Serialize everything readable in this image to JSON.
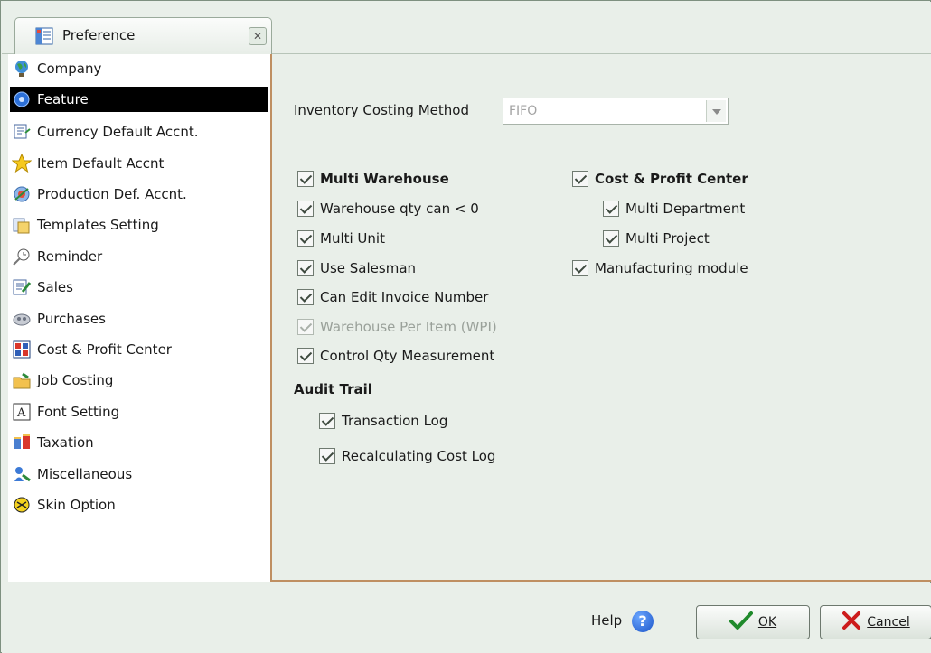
{
  "tab": {
    "title": "Preference",
    "close_glyph": "✕"
  },
  "sidebar": {
    "items": [
      {
        "label": "Company",
        "icon": "globe-icon",
        "selected": false
      },
      {
        "label": "Feature",
        "icon": "feature-icon",
        "selected": true
      },
      {
        "label": "Currency Default Accnt.",
        "icon": "currency-icon",
        "selected": false
      },
      {
        "label": "Item Default Accnt",
        "icon": "star-icon",
        "selected": false
      },
      {
        "label": "Production Def. Accnt.",
        "icon": "production-icon",
        "selected": false
      },
      {
        "label": "Templates Setting",
        "icon": "templates-icon",
        "selected": false
      },
      {
        "label": "Reminder",
        "icon": "reminder-icon",
        "selected": false
      },
      {
        "label": "Sales",
        "icon": "sales-icon",
        "selected": false
      },
      {
        "label": "Purchases",
        "icon": "purchases-icon",
        "selected": false
      },
      {
        "label": "Cost & Profit Center",
        "icon": "cost-center-icon",
        "selected": false
      },
      {
        "label": "Job Costing",
        "icon": "job-costing-icon",
        "selected": false
      },
      {
        "label": "Font Setting",
        "icon": "font-icon",
        "selected": false
      },
      {
        "label": "Taxation",
        "icon": "taxation-icon",
        "selected": false
      },
      {
        "label": "Miscellaneous",
        "icon": "miscellaneous-icon",
        "selected": false
      },
      {
        "label": "Skin Option",
        "icon": "skin-icon",
        "selected": false
      }
    ]
  },
  "main": {
    "costing_label": "Inventory Costing Method",
    "costing_value": "FIFO",
    "checkboxes": {
      "multi_warehouse": {
        "label": "Multi Warehouse",
        "checked": true
      },
      "warehouse_qty": {
        "label": "Warehouse qty can < 0",
        "checked": true
      },
      "multi_unit": {
        "label": "Multi Unit",
        "checked": true
      },
      "use_salesman": {
        "label": "Use Salesman",
        "checked": true
      },
      "edit_invoice": {
        "label": "Can Edit Invoice Number",
        "checked": true
      },
      "wpi": {
        "label": "Warehouse Per Item (WPI)",
        "checked": true,
        "disabled": true
      },
      "control_qty": {
        "label": "Control Qty Measurement",
        "checked": true
      },
      "cost_profit": {
        "label": "Cost & Profit Center",
        "checked": true
      },
      "multi_department": {
        "label": "Multi Department",
        "checked": true
      },
      "multi_project": {
        "label": "Multi Project",
        "checked": true
      },
      "manufacturing": {
        "label": "Manufacturing module",
        "checked": true
      },
      "transaction_log": {
        "label": "Transaction Log",
        "checked": true
      },
      "recalc_log": {
        "label": "Recalculating Cost Log",
        "checked": true
      }
    },
    "audit_title": "Audit Trail"
  },
  "footer": {
    "help_label": "Help",
    "help_glyph": "?",
    "ok_label": "OK",
    "cancel_label": "Cancel"
  },
  "colors": {
    "background": "#e9efe9",
    "selected_bg": "#000000",
    "panel_border": "#bf8f62"
  }
}
